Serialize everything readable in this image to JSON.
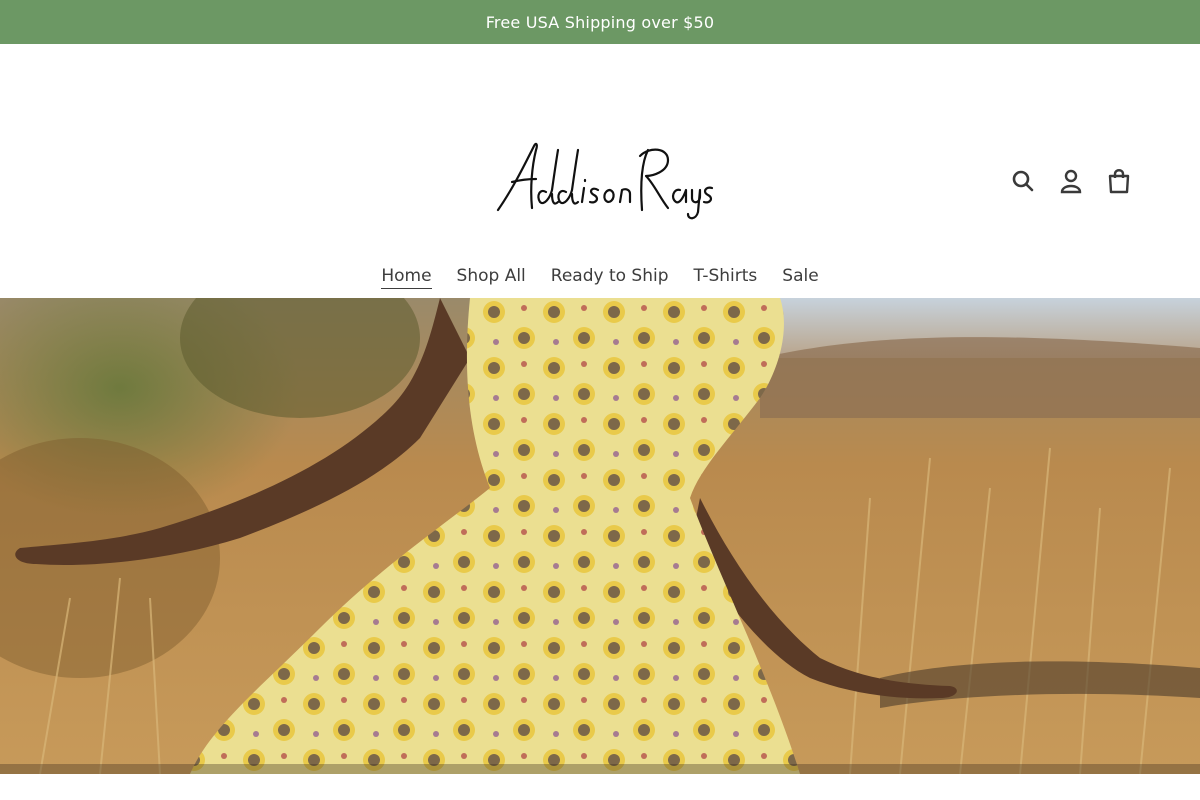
{
  "announcement": {
    "text": "Free USA Shipping over $50"
  },
  "header": {
    "logo_text": "Addison Rays",
    "icons": {
      "search": "search-icon",
      "account": "account-icon",
      "cart": "cart-icon"
    }
  },
  "nav": {
    "active": "Home",
    "items": [
      {
        "label": "Home"
      },
      {
        "label": "Shop All"
      },
      {
        "label": "Ready to Ship"
      },
      {
        "label": "T-Shirts"
      },
      {
        "label": "Sale"
      }
    ]
  },
  "colors": {
    "announcement_bg": "#6c9864",
    "text": "#3a3a3a"
  }
}
